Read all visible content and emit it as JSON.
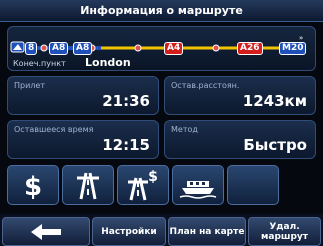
{
  "title": "Информация о маршруте",
  "route": {
    "roads": [
      "8",
      "A8",
      "A8",
      "A4",
      "A26",
      "M20"
    ],
    "destination_label": "Конеч.пункт",
    "destination_city": "London"
  },
  "info": {
    "arrival_label": "Прилет",
    "arrival_value": "21:36",
    "distance_label": "Остав.расстоян.",
    "distance_value": "1243км",
    "time_label": "Оставшееся время",
    "time_value": "12:15",
    "method_label": "Метод",
    "method_value": "Быстро"
  },
  "options": [
    {
      "name": "toll-roads",
      "icon": "dollar-icon"
    },
    {
      "name": "highways",
      "icon": "highway-icon"
    },
    {
      "name": "toll-highways",
      "icon": "toll-highway-icon"
    },
    {
      "name": "ferries",
      "icon": "ferry-icon"
    },
    {
      "name": "empty",
      "icon": ""
    }
  ],
  "bottom": {
    "back_icon": "back-arrow-icon",
    "settings_label": "Настройки",
    "map_plan_label": "План на карте",
    "delete_route_label": "Удал. маршрут"
  },
  "colors": {
    "accent_blue": "#1f4fb8",
    "road_red": "#d41e1e",
    "route_yellow": "#f2c400"
  }
}
